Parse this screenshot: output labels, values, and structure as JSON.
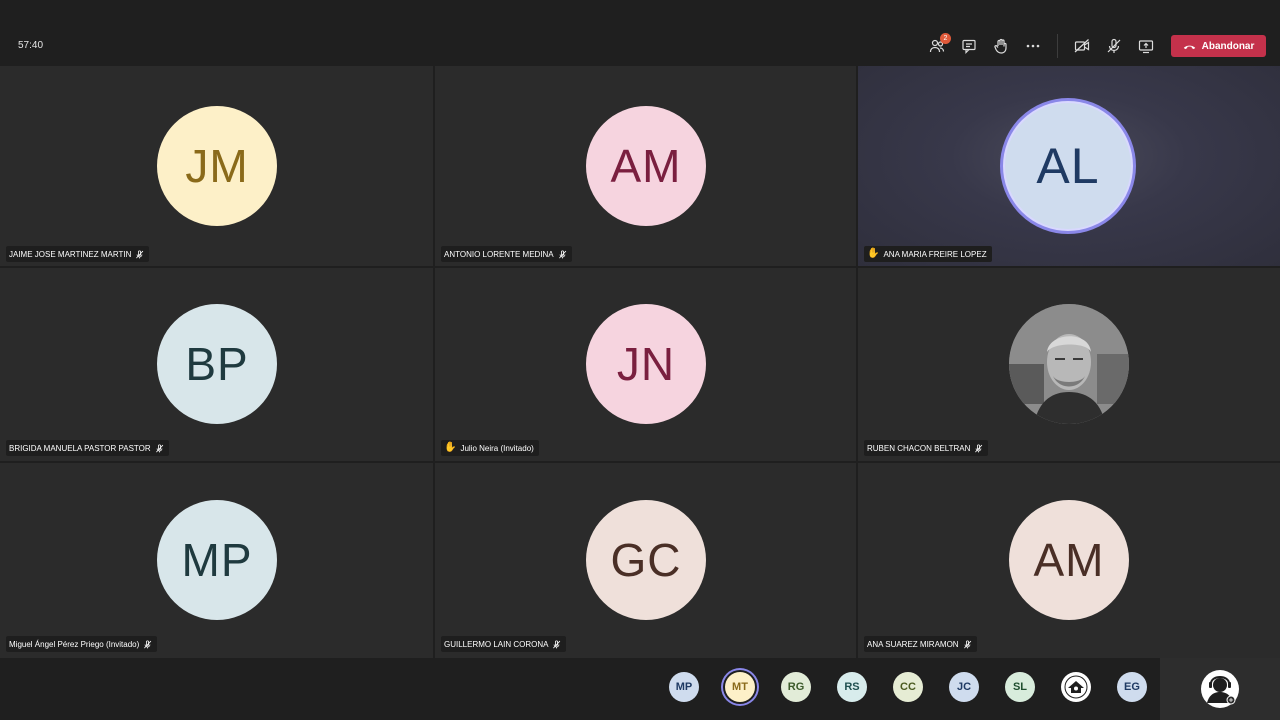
{
  "meeting": {
    "timer": "57:40",
    "participants_badge": "2",
    "leave_label": "Abandonar"
  },
  "toolbar_icons": [
    "participants-icon",
    "chat-icon",
    "raise-hand-icon",
    "more-options-icon",
    "camera-off-icon",
    "mic-off-icon",
    "share-screen-icon"
  ],
  "tiles": [
    {
      "initials": "JM",
      "name": "JAIME JOSE MARTINEZ MARTIN",
      "avatar_bg": "#fdf0c8",
      "avatar_fg": "#8a6a1a",
      "muted": true,
      "hand": false,
      "speaking": false
    },
    {
      "initials": "AM",
      "name": "ANTONIO LORENTE MEDINA",
      "avatar_bg": "#f6d4df",
      "avatar_fg": "#7a1f3f",
      "muted": true,
      "hand": false,
      "speaking": false
    },
    {
      "initials": "AL",
      "name": "ANA MARIA FREIRE LOPEZ",
      "avatar_bg": "#cfdcee",
      "avatar_fg": "#1f3a63",
      "muted": false,
      "hand": true,
      "speaking": true
    },
    {
      "initials": "BP",
      "name": "BRIGIDA MANUELA PASTOR PASTOR",
      "avatar_bg": "#d8e6ea",
      "avatar_fg": "#1f3a3f",
      "muted": true,
      "hand": false,
      "speaking": false
    },
    {
      "initials": "JN",
      "name": "Julio Neira (Invitado)",
      "avatar_bg": "#f6d4df",
      "avatar_fg": "#7a1f3f",
      "muted": false,
      "hand": true,
      "speaking": false
    },
    {
      "initials": "",
      "name": "RUBEN CHACON BELTRAN",
      "avatar_bg": "#6d6d6d",
      "avatar_fg": "#ffffff",
      "muted": true,
      "hand": false,
      "speaking": false,
      "photo": true
    },
    {
      "initials": "MP",
      "name": "Miguel Ángel Pérez Priego (Invitado)",
      "avatar_bg": "#d8e6ea",
      "avatar_fg": "#1f3a3f",
      "muted": true,
      "hand": false,
      "speaking": false
    },
    {
      "initials": "GC",
      "name": "GUILLERMO LAIN CORONA",
      "avatar_bg": "#efe0da",
      "avatar_fg": "#4a2f26",
      "muted": true,
      "hand": false,
      "speaking": false
    },
    {
      "initials": "AM",
      "name": "ANA SUAREZ MIRAMON",
      "avatar_bg": "#efe0da",
      "avatar_fg": "#4a2f26",
      "muted": true,
      "hand": false,
      "speaking": false
    }
  ],
  "gallery": [
    {
      "initials": "MP",
      "bg": "#cfdcee",
      "fg": "#1f3a63",
      "active": false
    },
    {
      "initials": "MT",
      "bg": "#fdf0c8",
      "fg": "#8a6a1a",
      "active": true
    },
    {
      "initials": "RG",
      "bg": "#e2ecd8",
      "fg": "#3b5a2a",
      "active": false
    },
    {
      "initials": "RS",
      "bg": "#d8ecec",
      "fg": "#1f4f4f",
      "active": false
    },
    {
      "initials": "CC",
      "bg": "#e6ecd4",
      "fg": "#4a5a1f",
      "active": false
    },
    {
      "initials": "JC",
      "bg": "#cfdcee",
      "fg": "#1f3a63",
      "active": false
    },
    {
      "initials": "SL",
      "bg": "#d8ecdc",
      "fg": "#1f4f2f",
      "active": false
    },
    {
      "initials": "",
      "bg": "#ffffff",
      "fg": "#1f1f1f",
      "active": false,
      "icon": "logo-avatar-icon"
    },
    {
      "initials": "EG",
      "bg": "#cfdcee",
      "fg": "#1f3a63",
      "active": false
    }
  ]
}
